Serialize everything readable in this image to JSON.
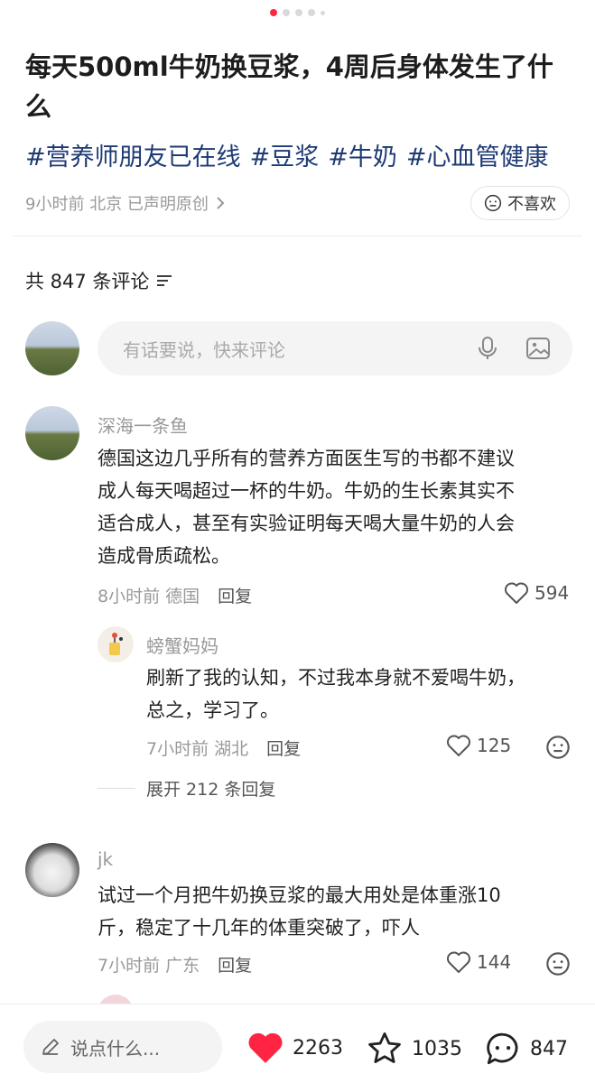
{
  "post": {
    "title": "每天500ml牛奶换豆浆，4周后身体发生了什么",
    "tags": [
      "#营养师朋友已在线",
      "#豆浆",
      "#牛奶",
      "#心血管健康"
    ],
    "meta": "9小时前 北京 已声明原创",
    "dislike_label": "不喜欢"
  },
  "comments_header": {
    "label": "共 847 条评论"
  },
  "comment_input": {
    "placeholder": "有话要说，快来评论"
  },
  "comments": [
    {
      "name": "深海一条鱼",
      "lines": [
        "德国这边几乎所有的营养方面医生写的书都不建议",
        "成人每天喝超过一杯的牛奶。牛奶的生长素其实不",
        "适合成人，甚至有实验证明每天喝大量牛奶的人会",
        "造成骨质疏松。"
      ],
      "time_loc": "8小时前 德国",
      "reply": "回复",
      "likes": "594"
    },
    {
      "name": "螃蟹妈妈",
      "lines": [
        "刷新了我的认知，不过我本身就不爱喝牛奶，",
        "总之，学习了。"
      ],
      "time_loc": "7小时前 湖北",
      "reply": "回复",
      "likes": "125"
    },
    {
      "name": "jk",
      "lines": [
        "试过一个月把牛奶换豆浆的最大用处是体重涨10",
        "斤，稳定了十几年的体重突破了，吓人"
      ],
      "time_loc": "7小时前 广东",
      "reply": "回复",
      "likes": "144"
    }
  ],
  "expand_replies": {
    "label": "展开 212 条回复"
  },
  "bottom_bar": {
    "say_placeholder": "说点什么...",
    "likes": "2263",
    "favorites": "1035",
    "comments": "847"
  },
  "colors": {
    "accent": "#ff2442",
    "tag": "#1d3a74",
    "muted": "#999999"
  },
  "icons": [
    "pencil-icon",
    "heart-filled-icon",
    "star-icon",
    "chat-bubble-icon",
    "microphone-icon",
    "image-icon",
    "neutral-face-icon",
    "heart-outline-icon",
    "sort-icon",
    "chevron-right-icon"
  ]
}
